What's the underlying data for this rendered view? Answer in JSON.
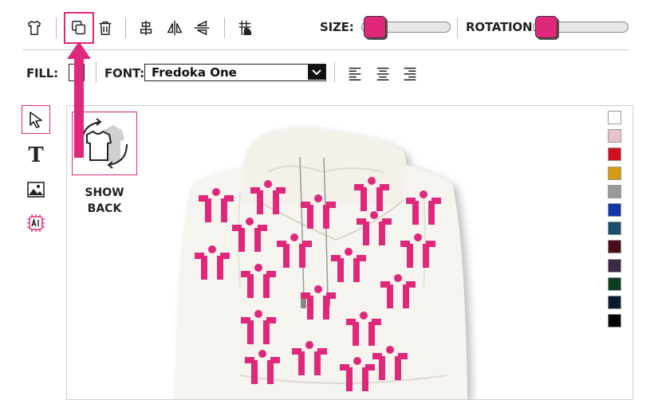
{
  "toolbar": {
    "size_label": "SIZE:",
    "rotation_label": "ROTATION:",
    "size_value": 0.03,
    "rotation_value": 0.03,
    "fill_label": "FILL:",
    "font_label": "FONT:",
    "font_value": "Fredoka One"
  },
  "side_panel": {
    "show_back_label": "SHOW BACK"
  },
  "colors": {
    "accent": "#e0287a",
    "garment": "#f6f4ee",
    "pattern": "#e0287a"
  },
  "color_swatches": [
    "#ffffff",
    "#e8c4c8",
    "#d0101c",
    "#d89a10",
    "#999999",
    "#1336a8",
    "#1c4f6a",
    "#4a0d18",
    "#3a2a46",
    "#0f3d24",
    "#0b1a2e",
    "#050505"
  ]
}
